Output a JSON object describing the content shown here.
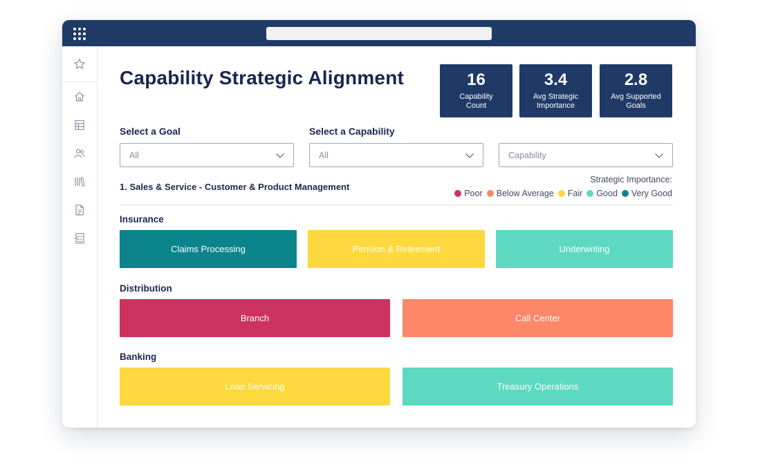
{
  "colors": {
    "poor": "#cc3360",
    "below_average": "#fe8769",
    "fair": "#fdd83f",
    "good": "#5dd9c1",
    "very_good": "#0b848c",
    "header": "#1f3a66"
  },
  "titlebar": {
    "menu_icon": "grid-icon",
    "address": ""
  },
  "sidebar": {
    "icons": [
      "star-icon",
      "home-icon",
      "table-icon",
      "users-icon",
      "library-icon",
      "document-icon",
      "checklist-icon"
    ]
  },
  "page": {
    "title": "Capability Strategic Alignment"
  },
  "kpis": [
    {
      "value": "16",
      "label_line1": "Capability",
      "label_line2": "Count"
    },
    {
      "value": "3.4",
      "label_line1": "Avg Strategic",
      "label_line2": "Importance"
    },
    {
      "value": "2.8",
      "label_line1": "Avg Supported",
      "label_line2": "Goals"
    }
  ],
  "filters": {
    "goal_label": "Select a Goal",
    "goal_value": "All",
    "capability_label": "Select a Capability",
    "capability_value": "All",
    "third_value": "Capability"
  },
  "section": {
    "title": "1. Sales & Service - Customer & Product Management"
  },
  "legend": {
    "title": "Strategic Importance:",
    "items": [
      {
        "label": "Poor",
        "level": "poor"
      },
      {
        "label": "Below Average",
        "level": "below_average"
      },
      {
        "label": "Fair",
        "level": "fair"
      },
      {
        "label": "Good",
        "level": "good"
      },
      {
        "label": "Very Good",
        "level": "very_good"
      }
    ]
  },
  "groups": [
    {
      "name": "Insurance",
      "tiles": [
        {
          "label": "Claims Processing",
          "level": "very_good"
        },
        {
          "label": "Pension & Retirement",
          "level": "fair"
        },
        {
          "label": "Underwriting",
          "level": "good"
        }
      ]
    },
    {
      "name": "Distribution",
      "tiles": [
        {
          "label": "Branch",
          "level": "poor"
        },
        {
          "label": "Call Center",
          "level": "below_average"
        }
      ]
    },
    {
      "name": "Banking",
      "tiles": [
        {
          "label": "Loan Servicing",
          "level": "fair"
        },
        {
          "label": "Treasury Operations",
          "level": "good"
        }
      ]
    }
  ]
}
